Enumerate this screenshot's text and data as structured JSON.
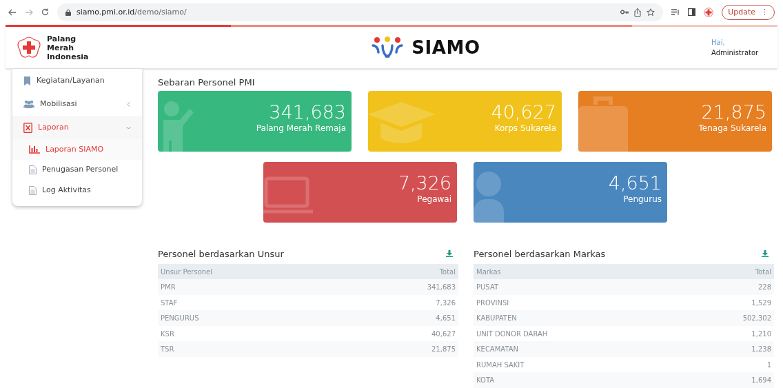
{
  "browser": {
    "url_host": "siamo.pmi.or.id",
    "url_path": "/demo/siamo/",
    "update_button": "Update",
    "menu_glyph": "⋮"
  },
  "header": {
    "org_name": [
      "Palang",
      "Merah",
      "Indonesia"
    ],
    "app_name": "SIAMO",
    "greeting": "Hai,",
    "user": "Administrator"
  },
  "sidebar": {
    "items": [
      {
        "label": "Kegiatan/Layanan",
        "kind": "link"
      },
      {
        "label": "Mobilisasi",
        "kind": "group",
        "expanded": false
      },
      {
        "label": "Laporan",
        "kind": "group",
        "expanded": true,
        "children": [
          {
            "label": "Laporan SIAMO",
            "selected": true
          },
          {
            "label": "Penugasan Personel",
            "selected": false
          },
          {
            "label": "Log Aktivitas",
            "selected": false
          }
        ]
      }
    ]
  },
  "section_title": "Sebaran Personel PMI",
  "stat_cards": [
    {
      "value": "341,683",
      "label": "Palang Merah Remaja",
      "color": "#37b87f",
      "kind": "waving-person"
    },
    {
      "value": "40,627",
      "label": "Korps Sukarela",
      "color": "#f0c21b",
      "kind": "graduation-cap"
    },
    {
      "value": "21,875",
      "label": "Tenaga Sukarela",
      "color": "#e67e22",
      "kind": "briefcase"
    },
    {
      "value": "7,326",
      "label": "Pegawai",
      "color": "#d35052",
      "kind": "laptop"
    },
    {
      "value": "4,651",
      "label": "Pengurus",
      "color": "#4a87bf",
      "kind": "user"
    }
  ],
  "tables": [
    {
      "title": "Personel berdasarkan Unsur",
      "columns": [
        "Unsur Personel",
        "Total"
      ],
      "rows": [
        [
          "PMR",
          "341,683"
        ],
        [
          "STAF",
          "7,326"
        ],
        [
          "PENGURUS",
          "4,651"
        ],
        [
          "KSR",
          "40,627"
        ],
        [
          "TSR",
          "21,875"
        ]
      ]
    },
    {
      "title": "Personel berdasarkan Markas",
      "columns": [
        "Markas",
        "Total"
      ],
      "rows": [
        [
          "PUSAT",
          "228"
        ],
        [
          "PROVINSI",
          "1,529"
        ],
        [
          "KABUPATEN",
          "502,302"
        ],
        [
          "UNIT DONOR DARAH",
          "1,210"
        ],
        [
          "KECAMATAN",
          "1,238"
        ],
        [
          "RUMAH SAKIT",
          "1"
        ],
        [
          "KOTA",
          "1,694"
        ]
      ]
    }
  ]
}
